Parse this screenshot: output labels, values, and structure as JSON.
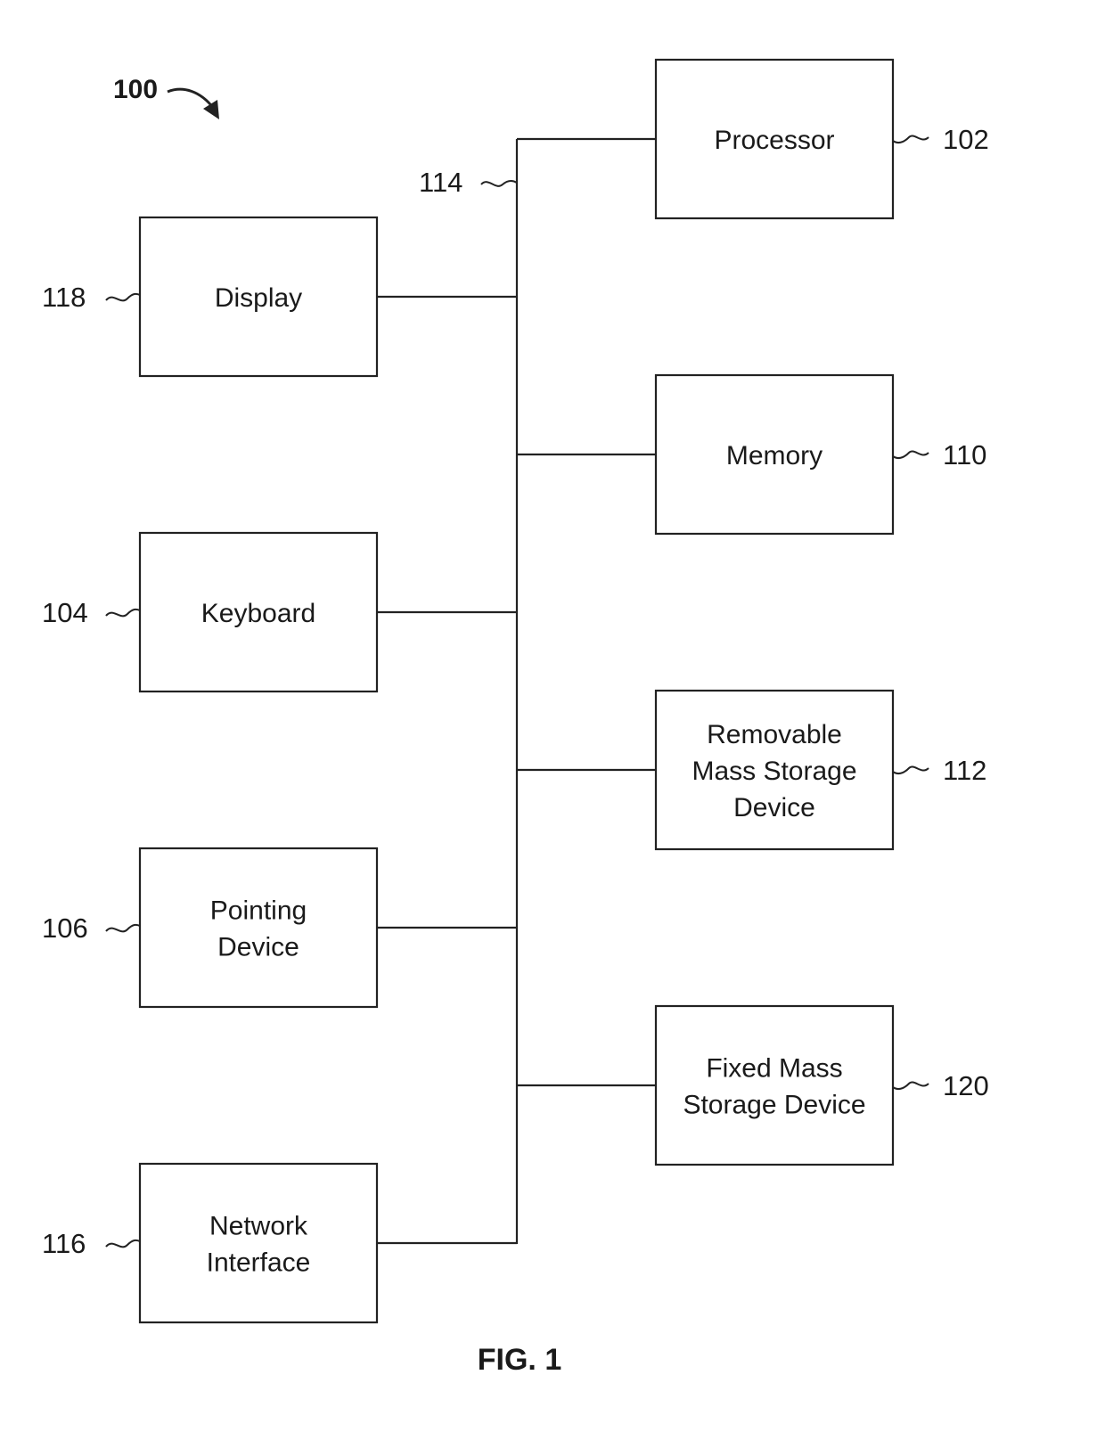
{
  "figure": {
    "reference": "100",
    "caption": "FIG. 1",
    "bus_reference": "114"
  },
  "left_components": [
    {
      "id": "display",
      "lines": [
        "Display"
      ],
      "reference": "118"
    },
    {
      "id": "keyboard",
      "lines": [
        "Keyboard"
      ],
      "reference": "104"
    },
    {
      "id": "pointing-device",
      "lines": [
        "Pointing",
        "Device"
      ],
      "reference": "106"
    },
    {
      "id": "network-interface",
      "lines": [
        "Network",
        "Interface"
      ],
      "reference": "116"
    }
  ],
  "right_components": [
    {
      "id": "processor",
      "lines": [
        "Processor"
      ],
      "reference": "102"
    },
    {
      "id": "memory",
      "lines": [
        "Memory"
      ],
      "reference": "110"
    },
    {
      "id": "removable-mass-storage-device",
      "lines": [
        "Removable",
        "Mass Storage",
        "Device"
      ],
      "reference": "112"
    },
    {
      "id": "fixed-mass-storage-device",
      "lines": [
        "Fixed Mass",
        "Storage Device"
      ],
      "reference": "120"
    }
  ]
}
